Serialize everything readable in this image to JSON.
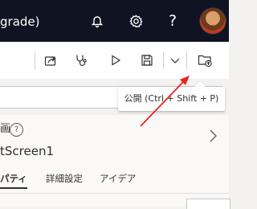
{
  "titlebar": {
    "title": "grade)",
    "icons": [
      "bell-icon",
      "gear-icon",
      "help-icon",
      "avatar"
    ],
    "help_glyph": "?"
  },
  "toolbar": {
    "icons": [
      "share-icon",
      "app-checker-icon",
      "preview-play-icon",
      "save-icon",
      "chevron-down-icon",
      "publish-icon"
    ]
  },
  "tooltip": {
    "text": "公開 (Ctrl + Shift + P)"
  },
  "panel": {
    "heading": "画",
    "info_glyph": "?",
    "screen_name": "tScreen1",
    "tabs": [
      {
        "label": "パティ",
        "selected": true
      },
      {
        "label": "詳細設定",
        "selected": false
      },
      {
        "label": "アイデア",
        "selected": false
      }
    ]
  },
  "colors": {
    "titlebar_bg": "#0f1322",
    "annotation_arrow": "#e8251f",
    "accent_dot": "#d13438"
  }
}
